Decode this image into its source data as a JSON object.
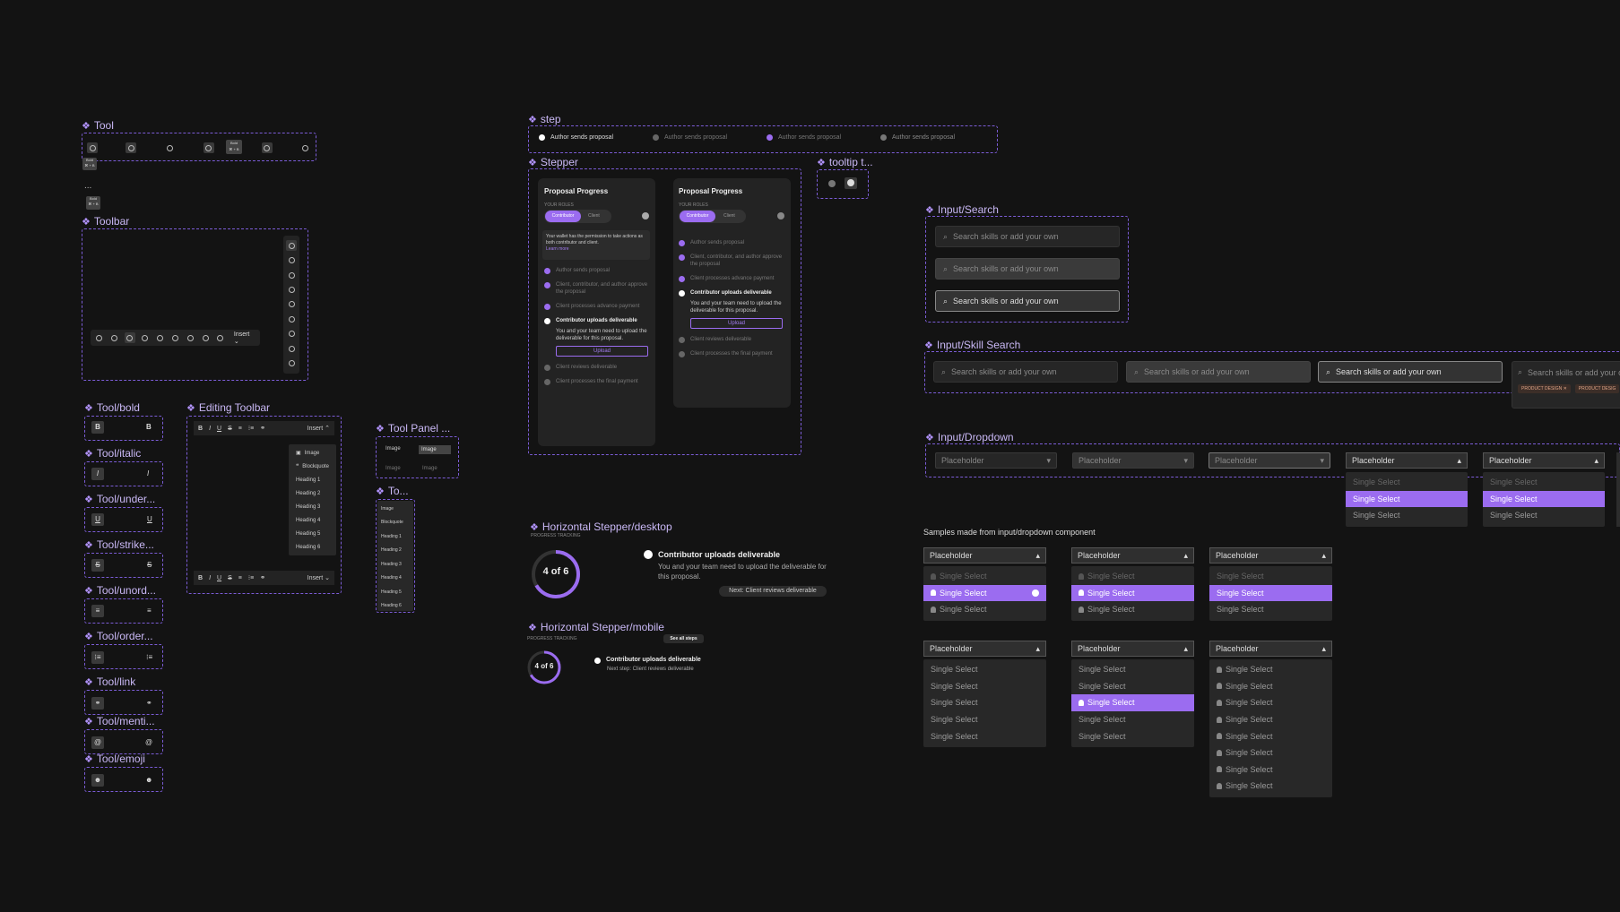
{
  "frames": {
    "tool": "Tool",
    "toolbar": "Toolbar",
    "tool_bold": "Tool/bold",
    "tool_italic": "Tool/italic",
    "tool_underline": "Tool/under...",
    "tool_strike": "Tool/strike...",
    "tool_unordered": "Tool/unord...",
    "tool_ordered": "Tool/order...",
    "tool_link": "Tool/link",
    "tool_mention": "Tool/menti...",
    "tool_emoji": "Tool/emoji",
    "editing_toolbar": "Editing Toolbar",
    "tool_panel": "Tool Panel ...",
    "to": "To...",
    "step": "step",
    "stepper": "Stepper",
    "tooltip": "tooltip t...",
    "h_stepper_desktop": "Horizontal Stepper/desktop",
    "h_stepper_mobile": "Horizontal Stepper/mobile",
    "input_search": "Input/Search",
    "input_skill_search": "Input/Skill Search",
    "input_dropdown": "Input/Dropdown"
  },
  "tooltip_bold": "Bold",
  "tooltip_shortcut": "⌘ + B",
  "ellipsis": "...",
  "insert_label": "Insert",
  "insert_menu": [
    "Image",
    "Blockquote",
    "Heading 1",
    "Heading 2",
    "Heading 3",
    "Heading 4",
    "Heading 5",
    "Heading 6"
  ],
  "tool_panel": {
    "image_a": "Image",
    "image_b": "Image",
    "image_c": "Image",
    "image_d": "Image"
  },
  "step_bar": [
    "Author sends proposal",
    "Author sends proposal",
    "Author sends proposal",
    "Author sends proposal"
  ],
  "stepper": {
    "title": "Proposal Progress",
    "roles_label": "YOUR ROLES",
    "role_contributor": "Contributor",
    "role_client": "Client",
    "wallet_note": "Your wallet has the permission to take actions as both contributor and client.",
    "learn_more": "Learn more",
    "steps": [
      "Author sends proposal",
      "Client, contributor, and author approve the proposal",
      "Client processes advance payment",
      "Contributor uploads deliverable",
      "Client reviews deliverable",
      "Client processes the final payment"
    ],
    "active_desc": "You and your team need to upload the deliverable for this proposal.",
    "upload": "Upload"
  },
  "h_desktop": {
    "tracking": "PROGRESS TRACKING",
    "ring": "4 of 6",
    "title": "Contributor uploads deliverable",
    "desc": "You and your team need to upload the deliverable for this proposal.",
    "next": "Next: Client reviews deliverable"
  },
  "h_mobile": {
    "tracking": "PROGRESS TRACKING",
    "see_all": "See all steps",
    "ring": "4 of 6",
    "title": "Contributor uploads deliverable",
    "next": "Next step: Client reviews deliverable"
  },
  "search_placeholder": "Search skills or add your own",
  "skill_search_filled": "Search skills or add your own",
  "skill_search_partial": "Search skills or add your ov",
  "chips": [
    "PRODUCT DESIGN",
    "PRODUCT DESIG"
  ],
  "dropdown": {
    "placeholder": "Placeholder",
    "option": "Single Select"
  },
  "samples_caption": "Samples made from input/dropdown component",
  "colors": {
    "accent": "#9b6cf0",
    "bg": "#131313",
    "border": "#7b5cd6"
  }
}
